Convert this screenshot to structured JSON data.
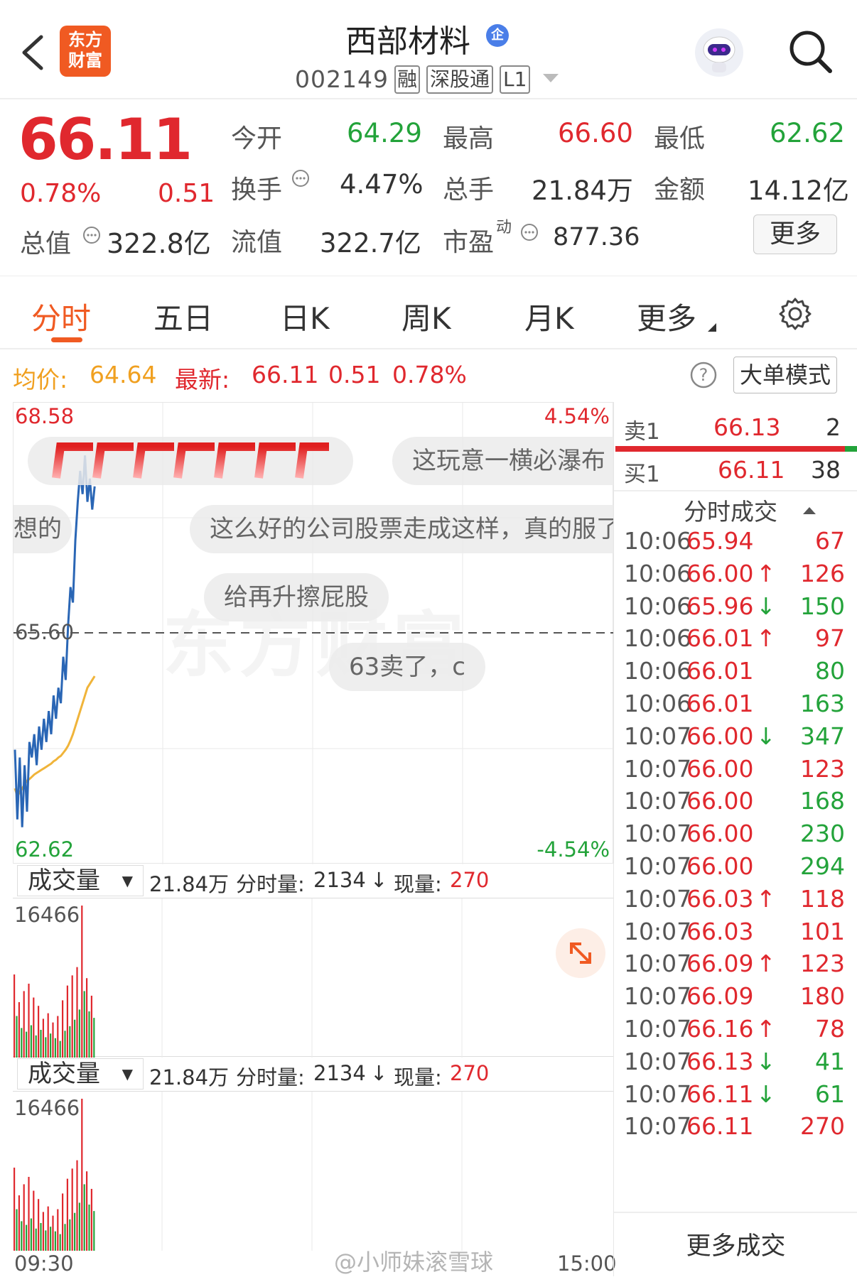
{
  "header": {
    "back_icon": "chevron-left-icon",
    "app_logo_text": [
      "东方",
      "财富"
    ],
    "stock_name": "西部材料",
    "enterprise_badge": "企",
    "stock_code": "002149",
    "tags": [
      "融",
      "深股通",
      "L1"
    ],
    "colors": {
      "brand": "#f05a22",
      "badge_blue": "#4a7ee8"
    }
  },
  "quote": {
    "price": "66.11",
    "change_pct": "0.78%",
    "change": "0.51",
    "market_cap_label": "总值",
    "market_cap": "322.8亿",
    "fields": [
      {
        "label": "今开",
        "value": "64.29",
        "color": "green"
      },
      {
        "label": "最高",
        "value": "66.60",
        "color": "red"
      },
      {
        "label": "最低",
        "value": "62.62",
        "color": "green"
      },
      {
        "label": "换手",
        "value": "4.47%",
        "color": "dark"
      },
      {
        "label": "总手",
        "value": "21.84万",
        "color": "dark"
      },
      {
        "label": "金额",
        "value": "14.12亿",
        "color": "dark"
      },
      {
        "label": "流值",
        "value": "322.7亿",
        "color": "dark"
      },
      {
        "label": "市盈",
        "sup": "动",
        "value": "877.36",
        "color": "dark"
      }
    ],
    "more_button": "更多"
  },
  "tabs": {
    "items": [
      "分时",
      "五日",
      "日K",
      "周K",
      "月K",
      "更多"
    ],
    "active": 0,
    "settings_icon": "gear-icon"
  },
  "infobar": {
    "avg_label": "均价:",
    "avg_value": "64.64",
    "latest_label": "最新:",
    "latest_value": "66.11",
    "latest_change": "0.51",
    "latest_pct": "0.78%",
    "help_icon": "question-icon",
    "big_order_button": "大单模式"
  },
  "chart_labels": {
    "y_max": "68.58",
    "y_mid": "65.60",
    "y_min": "62.62",
    "pct_max": "4.54%",
    "pct_min": "-4.54%",
    "watermark": "东方财富"
  },
  "danmu": [
    "这玩意一横必瀑布",
    "想的",
    "这么好的公司股票走成这样，真的服了",
    "给再升擦屁股",
    "63卖了，c"
  ],
  "volume_panels": [
    {
      "selector": "成交量",
      "total": "21.84万",
      "period_label": "分时量:",
      "period_value": "2134",
      "arrow": "↓",
      "now_label": "现量:",
      "now_value": "270",
      "max_label": "16466"
    },
    {
      "selector": "成交量",
      "total": "21.84万",
      "period_label": "分时量:",
      "period_value": "2134",
      "arrow": "↓",
      "now_label": "现量:",
      "now_value": "270",
      "max_label": "16466"
    }
  ],
  "time_axis": {
    "start": "09:30",
    "end": "15:00"
  },
  "order_book": {
    "sell": {
      "label": "卖1",
      "price": "66.13",
      "volume": "2"
    },
    "buy": {
      "label": "买1",
      "price": "66.11",
      "volume": "38"
    },
    "buy_ratio": 0.95
  },
  "trades_header": "分时成交",
  "trades": [
    {
      "time": "10:06",
      "price": "65.94",
      "arrow": "",
      "vol": "67",
      "pc": "red",
      "vc": "red"
    },
    {
      "time": "10:06",
      "price": "66.00",
      "arrow": "↑",
      "vol": "126",
      "pc": "red",
      "vc": "red"
    },
    {
      "time": "10:06",
      "price": "65.96",
      "arrow": "↓",
      "vol": "150",
      "pc": "red",
      "vc": "green"
    },
    {
      "time": "10:06",
      "price": "66.01",
      "arrow": "↑",
      "vol": "97",
      "pc": "red",
      "vc": "red"
    },
    {
      "time": "10:06",
      "price": "66.01",
      "arrow": "",
      "vol": "80",
      "pc": "red",
      "vc": "green"
    },
    {
      "time": "10:06",
      "price": "66.01",
      "arrow": "",
      "vol": "163",
      "pc": "red",
      "vc": "green"
    },
    {
      "time": "10:07",
      "price": "66.00",
      "arrow": "↓",
      "vol": "347",
      "pc": "red",
      "vc": "green"
    },
    {
      "time": "10:07",
      "price": "66.00",
      "arrow": "",
      "vol": "123",
      "pc": "red",
      "vc": "red"
    },
    {
      "time": "10:07",
      "price": "66.00",
      "arrow": "",
      "vol": "168",
      "pc": "red",
      "vc": "green"
    },
    {
      "time": "10:07",
      "price": "66.00",
      "arrow": "",
      "vol": "230",
      "pc": "red",
      "vc": "green"
    },
    {
      "time": "10:07",
      "price": "66.00",
      "arrow": "",
      "vol": "294",
      "pc": "red",
      "vc": "green"
    },
    {
      "time": "10:07",
      "price": "66.03",
      "arrow": "↑",
      "vol": "118",
      "pc": "red",
      "vc": "red"
    },
    {
      "time": "10:07",
      "price": "66.03",
      "arrow": "",
      "vol": "101",
      "pc": "red",
      "vc": "red"
    },
    {
      "time": "10:07",
      "price": "66.09",
      "arrow": "↑",
      "vol": "123",
      "pc": "red",
      "vc": "red"
    },
    {
      "time": "10:07",
      "price": "66.09",
      "arrow": "",
      "vol": "180",
      "pc": "red",
      "vc": "red"
    },
    {
      "time": "10:07",
      "price": "66.16",
      "arrow": "↑",
      "vol": "78",
      "pc": "red",
      "vc": "red"
    },
    {
      "time": "10:07",
      "price": "66.13",
      "arrow": "↓",
      "vol": "41",
      "pc": "red",
      "vc": "green"
    },
    {
      "time": "10:07",
      "price": "66.11",
      "arrow": "↓",
      "vol": "61",
      "pc": "red",
      "vc": "green"
    },
    {
      "time": "10:07",
      "price": "66.11",
      "arrow": "",
      "vol": "270",
      "pc": "red",
      "vc": "red"
    }
  ],
  "more_trades": "更多成交",
  "footer_watermark": "@小师妹滚雪球",
  "chart_data": {
    "type": "line",
    "ylim": [
      62.62,
      68.58
    ],
    "series": [
      {
        "values": [
          64.1,
          63.2,
          64.0,
          63.1,
          63.9,
          63.3,
          64.2,
          64.0,
          64.3,
          63.9,
          64.4,
          64.1,
          64.5,
          64.2,
          64.6,
          64.3,
          64.8,
          64.5,
          64.9,
          64.7,
          65.3,
          65.0,
          65.7,
          66.2,
          66.0,
          66.8,
          67.3,
          67.7,
          67.4,
          67.9,
          67.3,
          67.6,
          67.2,
          67.5
        ],
        "color": "#2a66b5"
      },
      {
        "values": [
          63.6,
          63.5,
          63.55,
          63.6,
          63.65,
          63.7,
          63.72,
          63.75,
          63.78,
          63.8,
          63.82,
          63.84,
          63.86,
          63.88,
          63.9,
          63.92,
          63.95,
          63.97,
          64.0,
          64.02,
          64.06,
          64.1,
          64.15,
          64.22,
          64.3,
          64.4,
          64.5,
          64.6,
          64.7,
          64.8,
          64.9,
          64.95,
          65.0,
          65.05
        ],
        "color": "#f0b43a"
      }
    ],
    "volume": [
      9000,
      4500,
      6000,
      3200,
      7200,
      2800,
      8000,
      3500,
      6500,
      2400,
      5600,
      3000,
      4200,
      2200,
      4800,
      2600,
      3800,
      2100,
      4500,
      1800,
      6200,
      2900,
      7800,
      3400,
      8900,
      4100,
      9800,
      5200,
      16466,
      7200,
      8600,
      5000,
      6700,
      4300
    ]
  }
}
